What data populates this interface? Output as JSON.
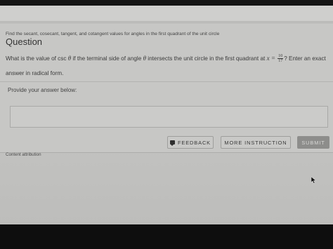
{
  "breadcrumb": "Find the secant, cosecant, tangent, and cotangent values for angles in the first quadrant of the unit circle",
  "question": {
    "heading": "Question",
    "text_before_var": "What is the value of csc ",
    "theta": "θ",
    "text_middle": " if the terminal side of angle ",
    "text_after_theta2": " intersects the unit circle in the first quadrant at ",
    "x_expr": "x =",
    "frac_num": "10",
    "frac_den": "17",
    "text_end": "? Enter an exact answer in radical form."
  },
  "answer": {
    "prompt": "Provide your answer below:",
    "value": ""
  },
  "buttons": {
    "feedback": "FEEDBACK",
    "more_instruction": "MORE INSTRUCTION",
    "submit": "SUBMIT"
  },
  "footer": {
    "attribution": "Content attribution"
  },
  "icons": {
    "feedback": "speech-bubble-icon",
    "cursor": "mouse-pointer-icon"
  },
  "colors": {
    "page_bg": "#c7c7c5",
    "submit_bg": "#8d8d8b",
    "bezel": "#0e0e0e"
  }
}
